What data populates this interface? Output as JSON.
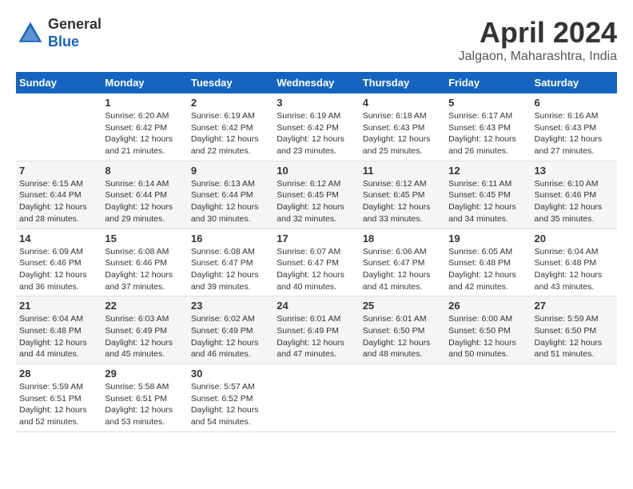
{
  "header": {
    "logo_line1": "General",
    "logo_line2": "Blue",
    "month": "April 2024",
    "location": "Jalgaon, Maharashtra, India"
  },
  "weekdays": [
    "Sunday",
    "Monday",
    "Tuesday",
    "Wednesday",
    "Thursday",
    "Friday",
    "Saturday"
  ],
  "weeks": [
    [
      {
        "day": "",
        "sunrise": "",
        "sunset": "",
        "daylight": ""
      },
      {
        "day": "1",
        "sunrise": "Sunrise: 6:20 AM",
        "sunset": "Sunset: 6:42 PM",
        "daylight": "Daylight: 12 hours and 21 minutes."
      },
      {
        "day": "2",
        "sunrise": "Sunrise: 6:19 AM",
        "sunset": "Sunset: 6:42 PM",
        "daylight": "Daylight: 12 hours and 22 minutes."
      },
      {
        "day": "3",
        "sunrise": "Sunrise: 6:19 AM",
        "sunset": "Sunset: 6:42 PM",
        "daylight": "Daylight: 12 hours and 23 minutes."
      },
      {
        "day": "4",
        "sunrise": "Sunrise: 6:18 AM",
        "sunset": "Sunset: 6:43 PM",
        "daylight": "Daylight: 12 hours and 25 minutes."
      },
      {
        "day": "5",
        "sunrise": "Sunrise: 6:17 AM",
        "sunset": "Sunset: 6:43 PM",
        "daylight": "Daylight: 12 hours and 26 minutes."
      },
      {
        "day": "6",
        "sunrise": "Sunrise: 6:16 AM",
        "sunset": "Sunset: 6:43 PM",
        "daylight": "Daylight: 12 hours and 27 minutes."
      }
    ],
    [
      {
        "day": "7",
        "sunrise": "Sunrise: 6:15 AM",
        "sunset": "Sunset: 6:44 PM",
        "daylight": "Daylight: 12 hours and 28 minutes."
      },
      {
        "day": "8",
        "sunrise": "Sunrise: 6:14 AM",
        "sunset": "Sunset: 6:44 PM",
        "daylight": "Daylight: 12 hours and 29 minutes."
      },
      {
        "day": "9",
        "sunrise": "Sunrise: 6:13 AM",
        "sunset": "Sunset: 6:44 PM",
        "daylight": "Daylight: 12 hours and 30 minutes."
      },
      {
        "day": "10",
        "sunrise": "Sunrise: 6:12 AM",
        "sunset": "Sunset: 6:45 PM",
        "daylight": "Daylight: 12 hours and 32 minutes."
      },
      {
        "day": "11",
        "sunrise": "Sunrise: 6:12 AM",
        "sunset": "Sunset: 6:45 PM",
        "daylight": "Daylight: 12 hours and 33 minutes."
      },
      {
        "day": "12",
        "sunrise": "Sunrise: 6:11 AM",
        "sunset": "Sunset: 6:45 PM",
        "daylight": "Daylight: 12 hours and 34 minutes."
      },
      {
        "day": "13",
        "sunrise": "Sunrise: 6:10 AM",
        "sunset": "Sunset: 6:46 PM",
        "daylight": "Daylight: 12 hours and 35 minutes."
      }
    ],
    [
      {
        "day": "14",
        "sunrise": "Sunrise: 6:09 AM",
        "sunset": "Sunset: 6:46 PM",
        "daylight": "Daylight: 12 hours and 36 minutes."
      },
      {
        "day": "15",
        "sunrise": "Sunrise: 6:08 AM",
        "sunset": "Sunset: 6:46 PM",
        "daylight": "Daylight: 12 hours and 37 minutes."
      },
      {
        "day": "16",
        "sunrise": "Sunrise: 6:08 AM",
        "sunset": "Sunset: 6:47 PM",
        "daylight": "Daylight: 12 hours and 39 minutes."
      },
      {
        "day": "17",
        "sunrise": "Sunrise: 6:07 AM",
        "sunset": "Sunset: 6:47 PM",
        "daylight": "Daylight: 12 hours and 40 minutes."
      },
      {
        "day": "18",
        "sunrise": "Sunrise: 6:06 AM",
        "sunset": "Sunset: 6:47 PM",
        "daylight": "Daylight: 12 hours and 41 minutes."
      },
      {
        "day": "19",
        "sunrise": "Sunrise: 6:05 AM",
        "sunset": "Sunset: 6:48 PM",
        "daylight": "Daylight: 12 hours and 42 minutes."
      },
      {
        "day": "20",
        "sunrise": "Sunrise: 6:04 AM",
        "sunset": "Sunset: 6:48 PM",
        "daylight": "Daylight: 12 hours and 43 minutes."
      }
    ],
    [
      {
        "day": "21",
        "sunrise": "Sunrise: 6:04 AM",
        "sunset": "Sunset: 6:48 PM",
        "daylight": "Daylight: 12 hours and 44 minutes."
      },
      {
        "day": "22",
        "sunrise": "Sunrise: 6:03 AM",
        "sunset": "Sunset: 6:49 PM",
        "daylight": "Daylight: 12 hours and 45 minutes."
      },
      {
        "day": "23",
        "sunrise": "Sunrise: 6:02 AM",
        "sunset": "Sunset: 6:49 PM",
        "daylight": "Daylight: 12 hours and 46 minutes."
      },
      {
        "day": "24",
        "sunrise": "Sunrise: 6:01 AM",
        "sunset": "Sunset: 6:49 PM",
        "daylight": "Daylight: 12 hours and 47 minutes."
      },
      {
        "day": "25",
        "sunrise": "Sunrise: 6:01 AM",
        "sunset": "Sunset: 6:50 PM",
        "daylight": "Daylight: 12 hours and 48 minutes."
      },
      {
        "day": "26",
        "sunrise": "Sunrise: 6:00 AM",
        "sunset": "Sunset: 6:50 PM",
        "daylight": "Daylight: 12 hours and 50 minutes."
      },
      {
        "day": "27",
        "sunrise": "Sunrise: 5:59 AM",
        "sunset": "Sunset: 6:50 PM",
        "daylight": "Daylight: 12 hours and 51 minutes."
      }
    ],
    [
      {
        "day": "28",
        "sunrise": "Sunrise: 5:59 AM",
        "sunset": "Sunset: 6:51 PM",
        "daylight": "Daylight: 12 hours and 52 minutes."
      },
      {
        "day": "29",
        "sunrise": "Sunrise: 5:58 AM",
        "sunset": "Sunset: 6:51 PM",
        "daylight": "Daylight: 12 hours and 53 minutes."
      },
      {
        "day": "30",
        "sunrise": "Sunrise: 5:57 AM",
        "sunset": "Sunset: 6:52 PM",
        "daylight": "Daylight: 12 hours and 54 minutes."
      },
      {
        "day": "",
        "sunrise": "",
        "sunset": "",
        "daylight": ""
      },
      {
        "day": "",
        "sunrise": "",
        "sunset": "",
        "daylight": ""
      },
      {
        "day": "",
        "sunrise": "",
        "sunset": "",
        "daylight": ""
      },
      {
        "day": "",
        "sunrise": "",
        "sunset": "",
        "daylight": ""
      }
    ]
  ]
}
